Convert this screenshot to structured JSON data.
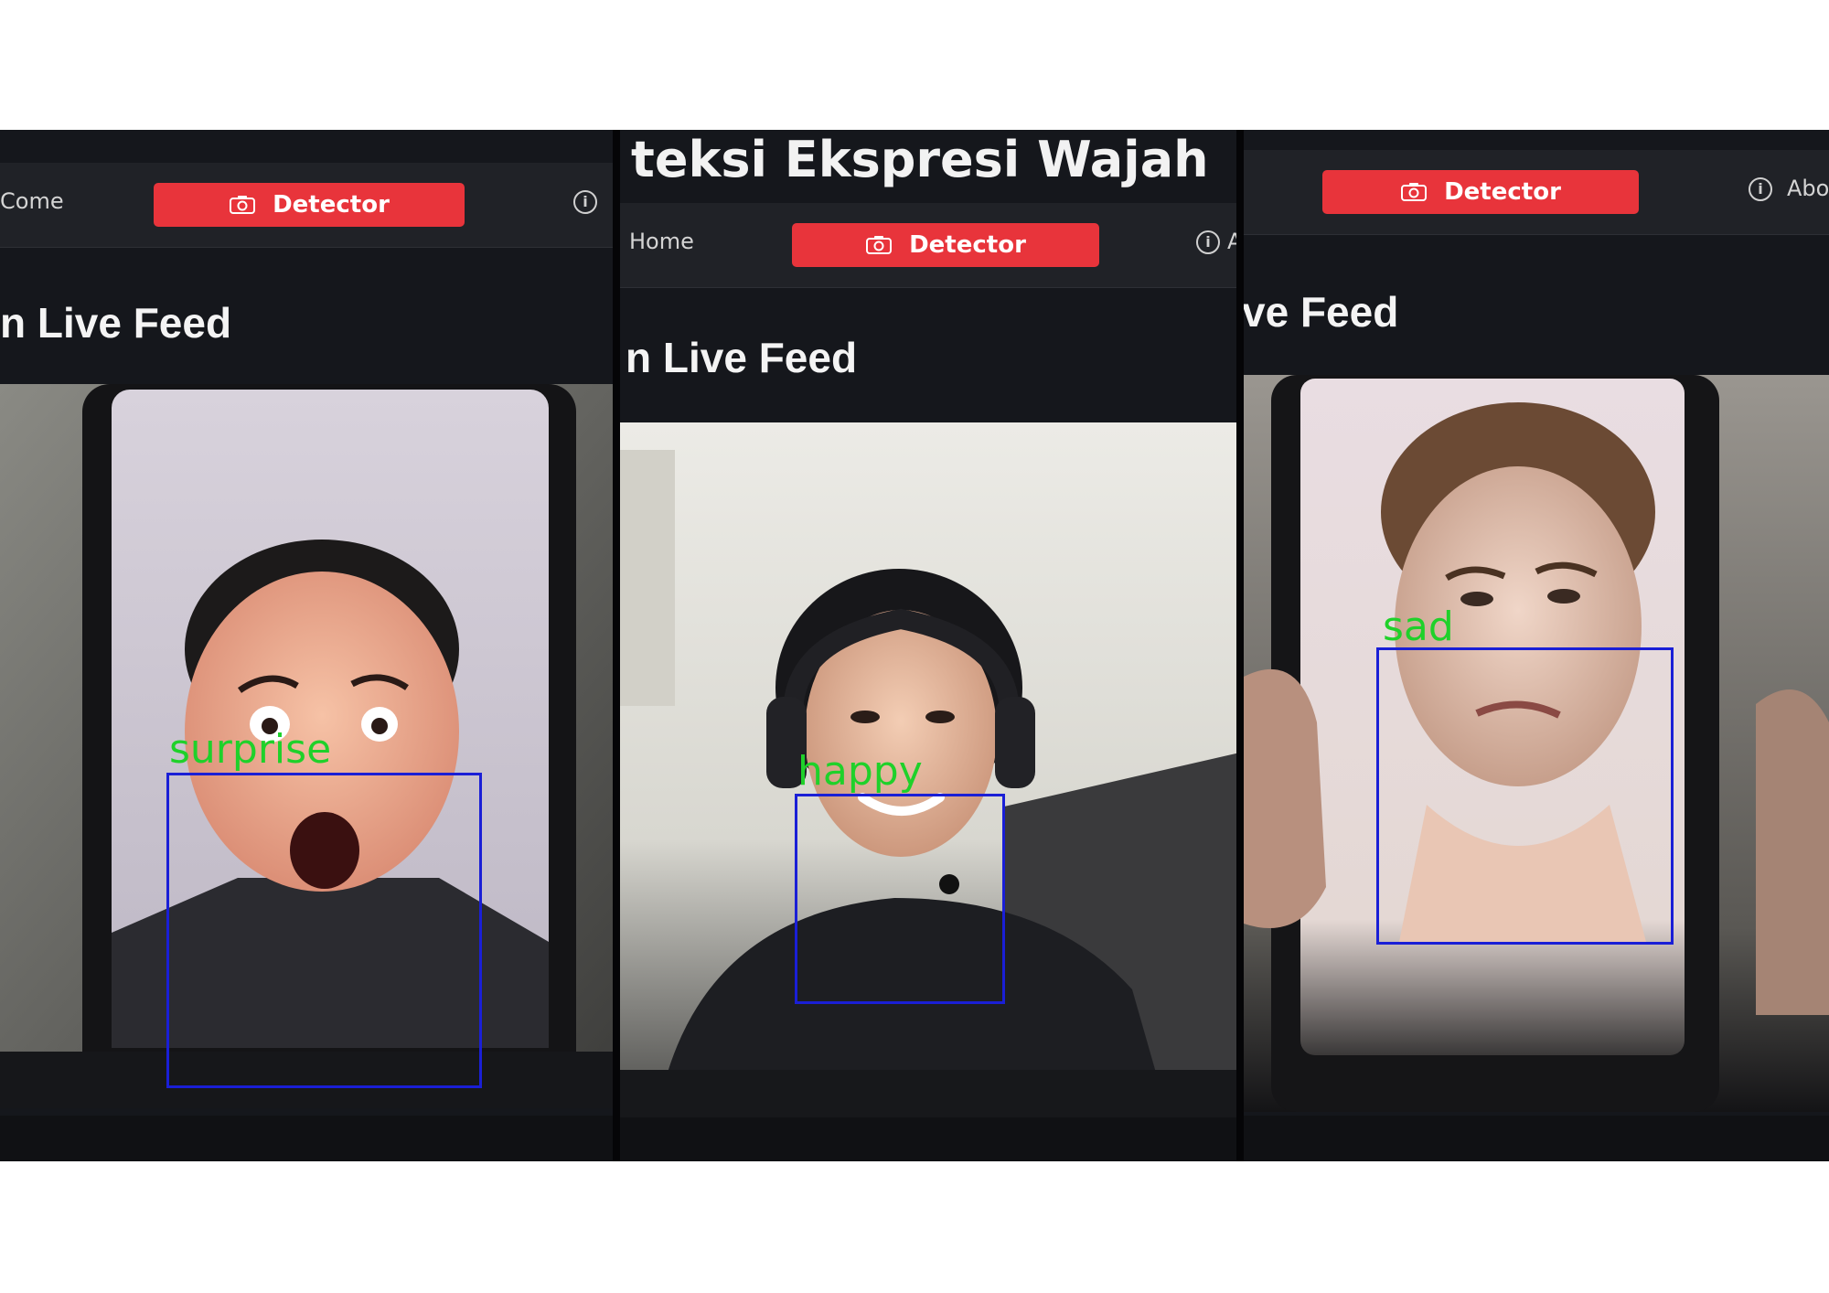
{
  "panels": [
    {
      "nav": {
        "home_label": "Come",
        "detector_label": "Detector",
        "info_label": "i"
      },
      "feed_title": "n Live Feed",
      "detection": {
        "label": "surprise",
        "box_color": "#1a1fd6",
        "label_color": "#1fd12a"
      },
      "camera_icon": "camera-icon",
      "info_icon": "info-icon"
    },
    {
      "page_heading": "teksi Ekspresi Wajah",
      "nav": {
        "home_label": "Home",
        "detector_label": "Detector",
        "info_label": "i",
        "extra_label": "A"
      },
      "feed_title": "n Live Feed",
      "detection": {
        "label": "happy",
        "box_color": "#1a1fd6",
        "label_color": "#1fd12a"
      },
      "camera_icon": "camera-icon",
      "info_icon": "info-icon"
    },
    {
      "nav": {
        "detector_label": "Detector",
        "info_label": "i",
        "about_label": "Abo"
      },
      "feed_title": "ve Feed",
      "detection": {
        "label": "sad",
        "box_color": "#1a1fd6",
        "label_color": "#1fd12a"
      },
      "camera_icon": "camera-icon",
      "info_icon": "info-icon",
      "volume_icon": "volume-icon"
    }
  ],
  "colors": {
    "accent": "#e8343b",
    "nav_bg": "#202227",
    "app_bg": "#15171c",
    "detection_box": "#1a1fd6",
    "detection_label": "#1fd12a"
  }
}
